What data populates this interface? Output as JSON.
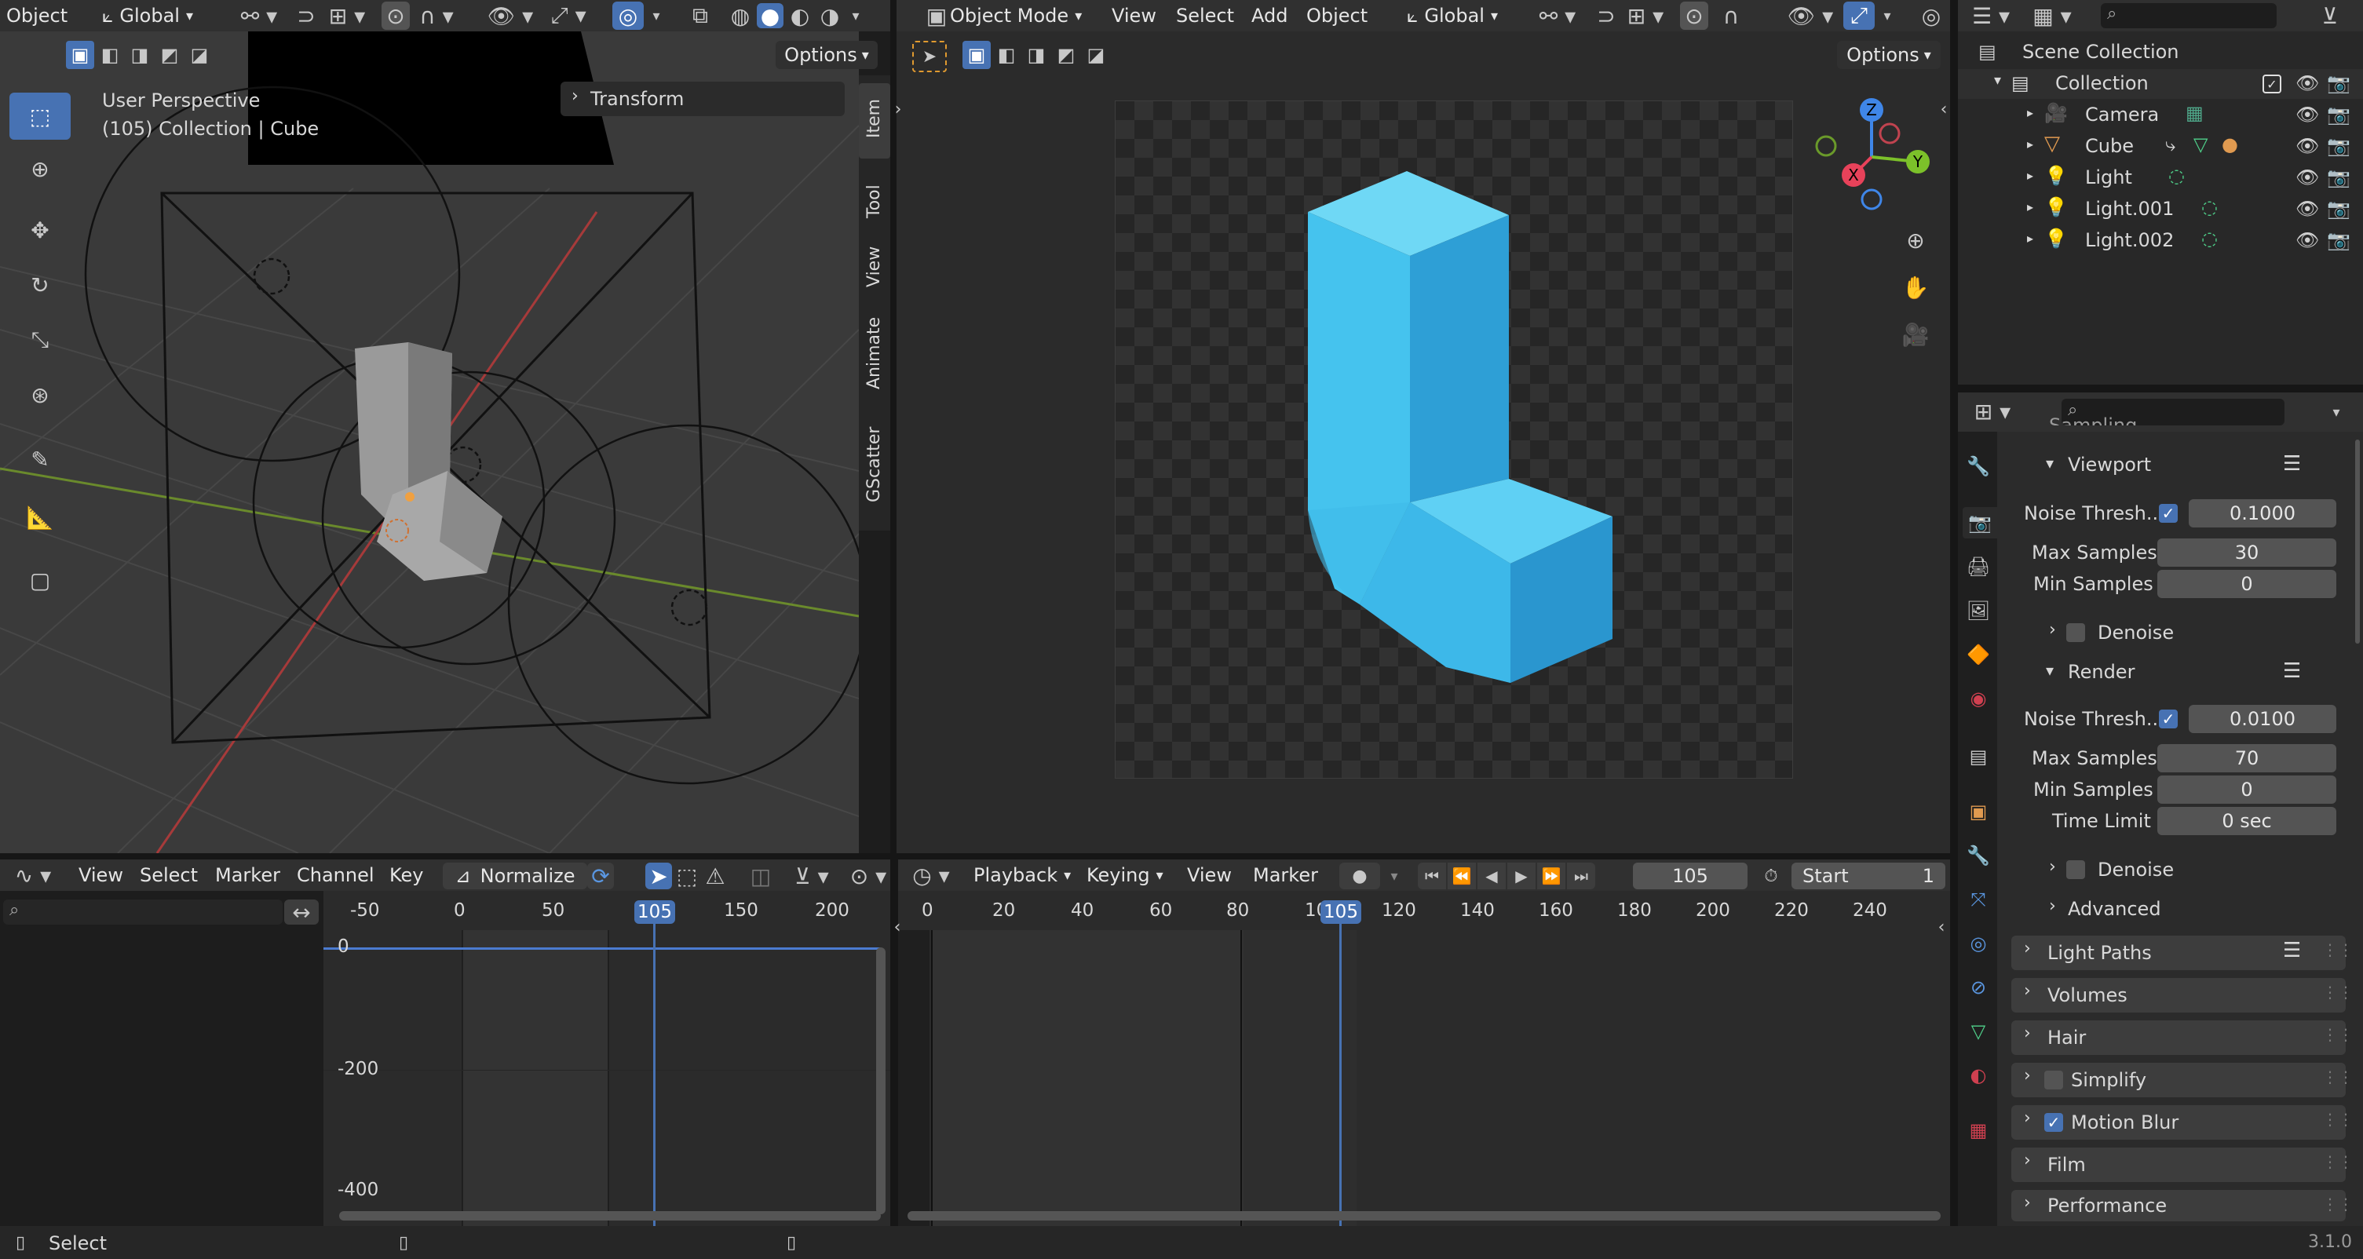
{
  "version": "3.1.0",
  "left_viewport": {
    "header": {
      "mode_label": "Object",
      "orientation": "Global",
      "options_label": "Options"
    },
    "overlay_text": {
      "line1": "User Perspective",
      "line2": "(105) Collection | Cube"
    },
    "transform_panel": "Transform",
    "side_tabs": [
      "Item",
      "Tool",
      "View",
      "Animate",
      "GScatter"
    ]
  },
  "render_viewport": {
    "header": {
      "mode": "Object Mode",
      "menus": [
        "View",
        "Select",
        "Add",
        "Object"
      ],
      "orientation": "Global",
      "options_label": "Options"
    }
  },
  "outliner": {
    "root": "Scene Collection",
    "collection": "Collection",
    "items": [
      {
        "name": "Camera",
        "icon": "camera-icon"
      },
      {
        "name": "Cube",
        "icon": "mesh-icon"
      },
      {
        "name": "Light",
        "icon": "light-icon"
      },
      {
        "name": "Light.001",
        "icon": "light-icon"
      },
      {
        "name": "Light.002",
        "icon": "light-icon"
      }
    ]
  },
  "properties": {
    "cut_header": "Sampling",
    "viewport": {
      "title": "Viewport",
      "noise_label": "Noise Thresh...",
      "noise_value": "0.1000",
      "max_label": "Max Samples",
      "max_value": "30",
      "min_label": "Min Samples",
      "min_value": "0",
      "denoise": "Denoise"
    },
    "render": {
      "title": "Render",
      "noise_label": "Noise Thresh...",
      "noise_value": "0.0100",
      "max_label": "Max Samples",
      "max_value": "70",
      "min_label": "Min Samples",
      "min_value": "0",
      "time_label": "Time Limit",
      "time_value": "0 sec",
      "denoise": "Denoise",
      "advanced": "Advanced"
    },
    "panels": [
      "Light Paths",
      "Volumes",
      "Hair",
      "Simplify",
      "Motion Blur",
      "Film",
      "Performance"
    ]
  },
  "graph_editor": {
    "menus": [
      "View",
      "Select",
      "Marker",
      "Channel",
      "Key"
    ],
    "normalize": "Normalize",
    "ruler": [
      "-50",
      "0",
      "50",
      "150",
      "200"
    ],
    "frame": "105",
    "y_labels": [
      "0",
      "-200",
      "-400"
    ]
  },
  "timeline": {
    "menus": [
      "Playback",
      "Keying",
      "View",
      "Marker"
    ],
    "current_frame": "105",
    "start_label": "Start",
    "start_value": "1",
    "ruler": [
      "0",
      "20",
      "40",
      "60",
      "80",
      "10",
      "120",
      "140",
      "160",
      "180",
      "200",
      "220",
      "240"
    ],
    "frame": "105"
  },
  "status": {
    "select": "Select"
  }
}
